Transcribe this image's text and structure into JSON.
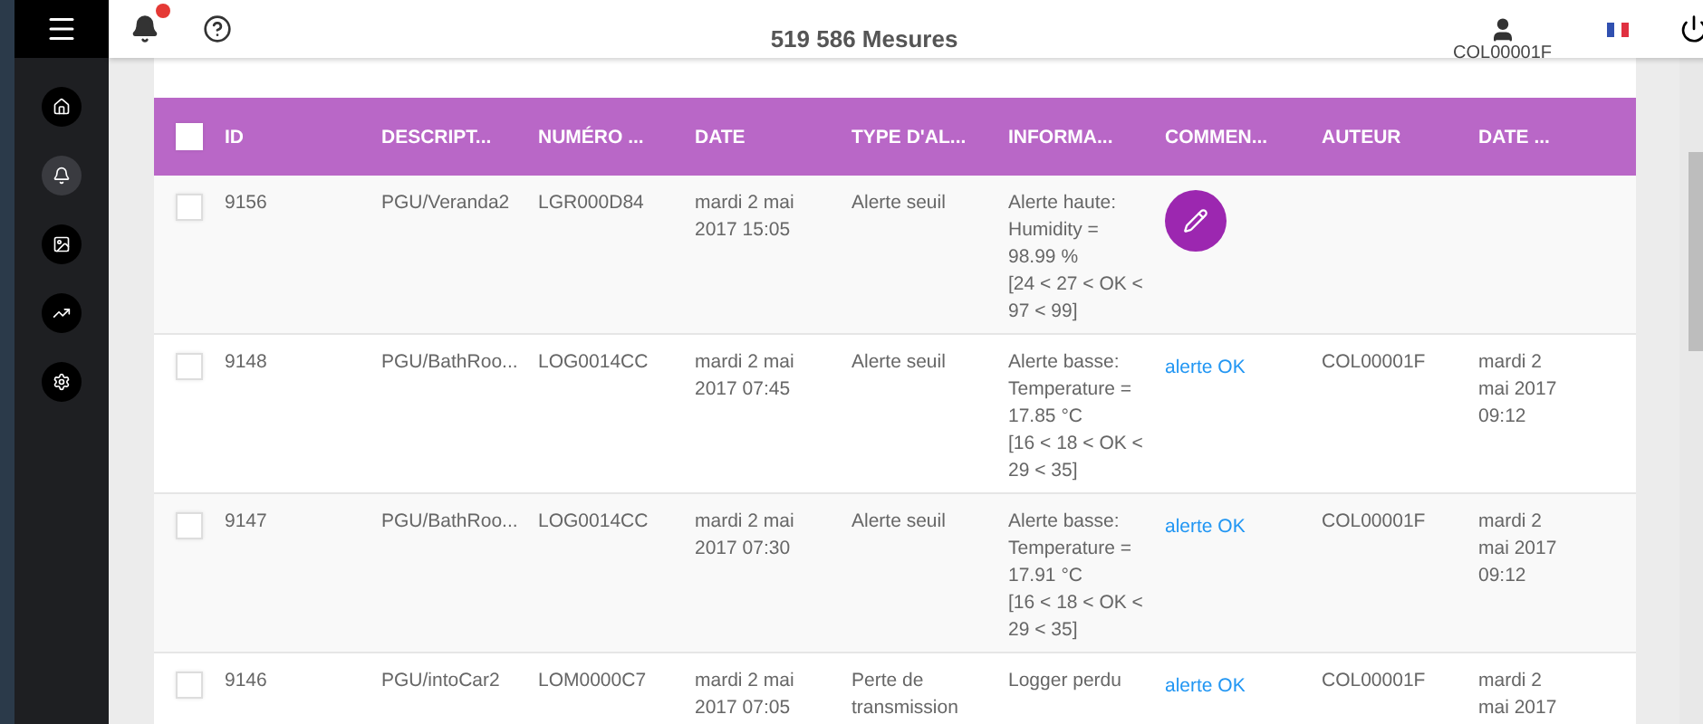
{
  "topbar": {
    "title": "519 586 Mesures",
    "user": "COL00001F",
    "notification_badge": true
  },
  "sidebar": {
    "items": [
      {
        "kind": "home",
        "selected": false
      },
      {
        "kind": "bell",
        "selected": true
      },
      {
        "kind": "data",
        "selected": false
      },
      {
        "kind": "chart",
        "selected": false
      },
      {
        "kind": "settings",
        "selected": false
      }
    ]
  },
  "table": {
    "all_checked": false,
    "columns": [
      "ID",
      "DESCRIPT...",
      "NUMÉRO ...",
      "DATE",
      "TYPE D'AL...",
      "INFORMA...",
      "COMMEN...",
      "AUTEUR",
      "DATE ..."
    ],
    "rows": [
      {
        "checked": false,
        "id": "9156",
        "description": "PGU/Veranda2",
        "number": "LGR000D84",
        "date": "mardi 2 mai 2017 15:05",
        "type": "Alerte seuil",
        "info": "Alerte haute: Humidity = 98.99 %",
        "range": "[24 < 27 < OK < 97 < 99]",
        "comment": {
          "kind": "edit"
        }
      },
      {
        "checked": false,
        "id": "9148",
        "description": "PGU/BathRoo...",
        "number": "LOG0014CC",
        "date": "mardi 2 mai 2017 07:45",
        "type": "Alerte seuil",
        "info": "Alerte basse: Temperature = 17.85 °C",
        "range": "[16 < 18 < OK < 29 < 35]",
        "comment": {
          "kind": "link",
          "text": "alerte OK"
        },
        "author": "COL00001F",
        "date_2": "mardi 2 mai 2017 09:12"
      },
      {
        "checked": false,
        "id": "9147",
        "description": "PGU/BathRoo...",
        "number": "LOG0014CC",
        "date": "mardi 2 mai 2017 07:30",
        "type": "Alerte seuil",
        "info": "Alerte basse: Temperature = 17.91 °C",
        "range": "[16 < 18 < OK < 29 < 35]",
        "comment": {
          "kind": "link",
          "text": "alerte OK"
        },
        "author": "COL00001F",
        "date_2": "mardi 2 mai 2017 09:12"
      },
      {
        "checked": false,
        "id": "9146",
        "description": "PGU/intoCar2",
        "number": "LOM0000C7",
        "date": "mardi 2 mai 2017 07:05",
        "type": "Perte de transmission",
        "info": "Logger perdu",
        "comment": {
          "kind": "link",
          "text": "alerte OK"
        },
        "author": "COL00001F",
        "date_2": "mardi 2 mai 2017"
      }
    ]
  }
}
